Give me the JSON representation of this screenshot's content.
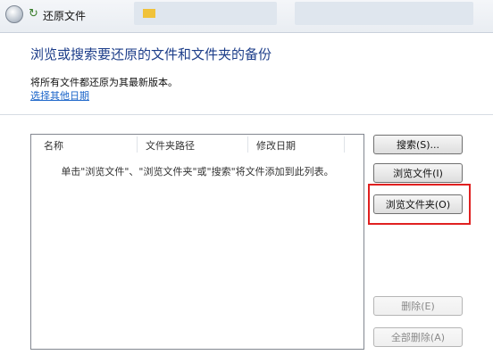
{
  "window": {
    "title": "还原文件"
  },
  "main": {
    "heading": "浏览或搜索要还原的文件和文件夹的备份",
    "description": "将所有文件都还原为其最新版本。",
    "choose_date_link": "选择其他日期"
  },
  "list": {
    "columns": [
      "名称",
      "文件夹路径",
      "修改日期"
    ],
    "empty_message": "单击\"浏览文件\"、\"浏览文件夹\"或\"搜索\"将文件添加到此列表。"
  },
  "buttons": {
    "search": "搜索(S)...",
    "browse_files": "浏览文件(I)",
    "browse_folders": "浏览文件夹(O)",
    "delete": "删除(E)",
    "delete_all": "全部删除(A)"
  },
  "colors": {
    "heading": "#1d3e8a",
    "link": "#1a64c9",
    "highlight": "#e02020"
  }
}
